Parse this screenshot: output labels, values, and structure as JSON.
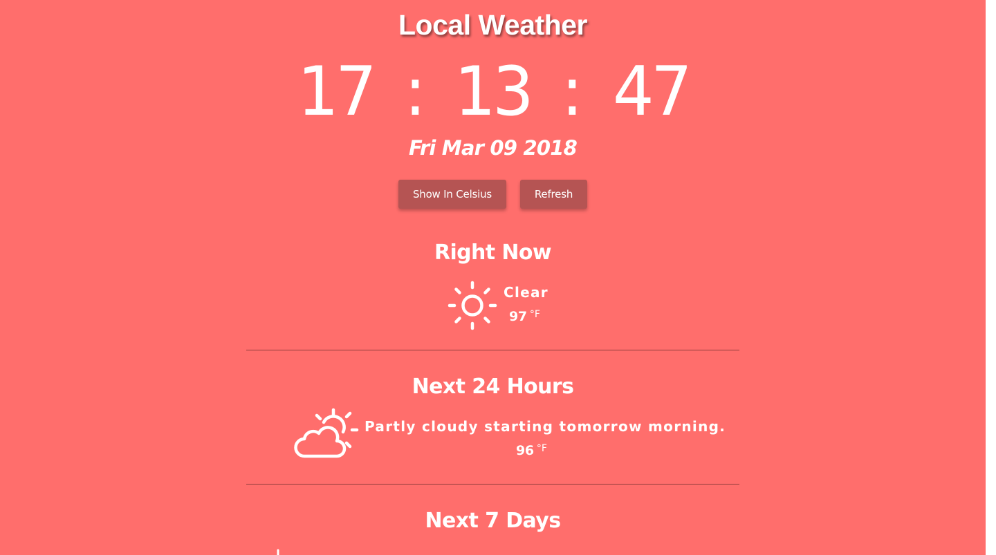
{
  "header": {
    "title": "Local Weather"
  },
  "clock": {
    "hours": "17",
    "minutes": "13",
    "seconds": "47",
    "separator": ":"
  },
  "date": "Fri Mar 09 2018",
  "controls": {
    "celsius_label": "Show In Celsius",
    "refresh_label": "Refresh"
  },
  "sections": {
    "now": {
      "title": "Right Now",
      "icon": "clear-day-sun-icon",
      "summary": "Clear",
      "temperature": "97",
      "unit": "°F"
    },
    "next24": {
      "title": "Next 24 Hours",
      "icon": "partly-cloudy-day-icon",
      "summary": "Partly cloudy starting tomorrow morning.",
      "temperature": "96",
      "unit": "°F"
    },
    "next7": {
      "title": "Next 7 Days",
      "icon": "weather-icon"
    }
  },
  "theme": {
    "background": "#ff6e6c",
    "button": "#b55453",
    "text": "#ffffff",
    "divider": "#8e3c3b"
  }
}
